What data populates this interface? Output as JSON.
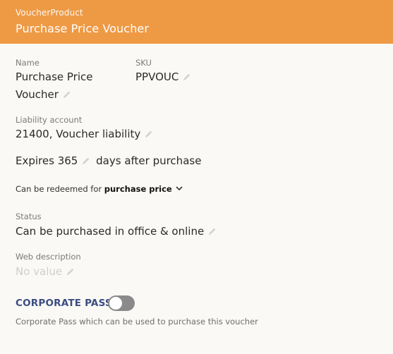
{
  "header": {
    "subtitle": "VoucherProduct",
    "title": "Purchase Price Voucher"
  },
  "fields": {
    "name_label": "Name",
    "name_line1": "Purchase Price",
    "name_line2": "Voucher",
    "sku_label": "SKU",
    "sku_value": "PPVOUC",
    "liability_label": "Liability account",
    "liability_value": "21400, Voucher liability",
    "expires_prefix": "Expires",
    "expires_days": "365",
    "expires_suffix": "days after purchase",
    "redeem_prefix": "Can be redeemed for",
    "redeem_value": "purchase price",
    "status_label": "Status",
    "status_value": "Can be purchased in office & online",
    "web_label": "Web description",
    "web_placeholder": "No value"
  },
  "corporate_pass": {
    "title": "CORPORATE PASS",
    "enabled": false,
    "description": "Corporate Pass which can be used to purchase this voucher"
  },
  "colors": {
    "header": "#ee9a45",
    "accent": "#3b4d83",
    "toggle_off": "#8a8a8a"
  }
}
